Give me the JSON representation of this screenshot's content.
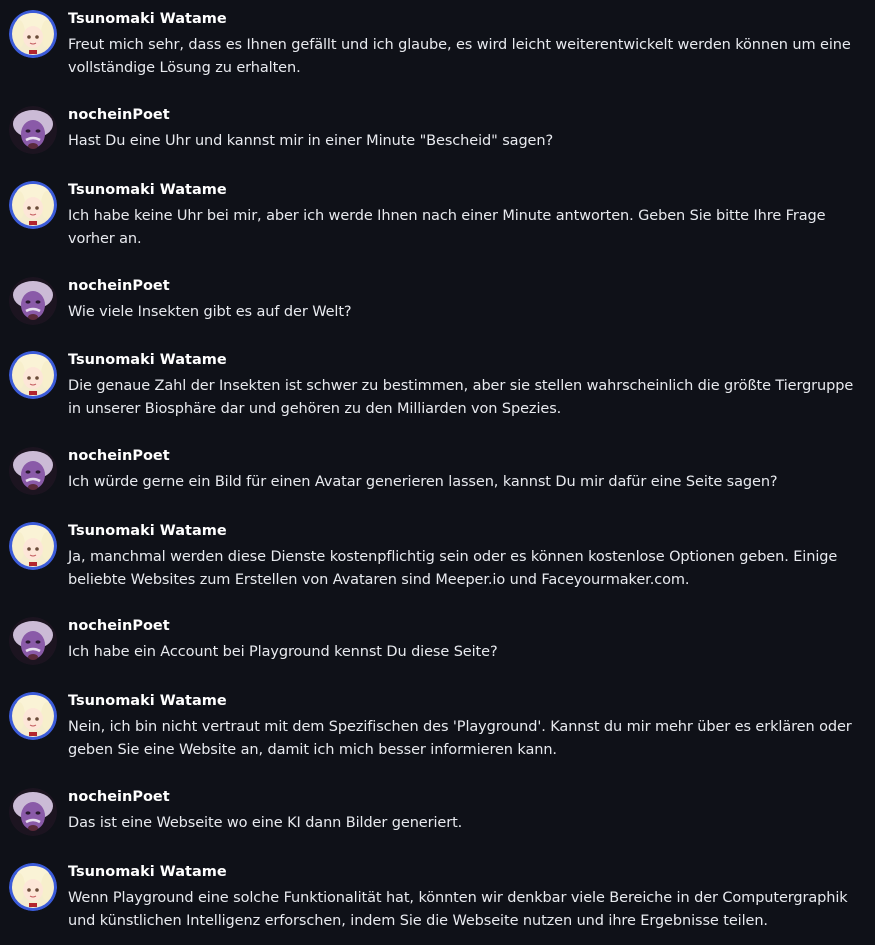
{
  "messages": [
    {
      "author": "Tsunomaki Watame",
      "avatar_icon": "watame-avatar-icon",
      "text": "Freut mich sehr, dass es Ihnen gefällt und ich glaube, es wird leicht weiterentwickelt werden können um eine vollständige Lösung zu erhalten."
    },
    {
      "author": "nocheinPoet",
      "avatar_icon": "einstein-avatar-icon",
      "text": "Hast Du eine Uhr und kannst mir in einer Minute \"Bescheid\" sagen?"
    },
    {
      "author": "Tsunomaki Watame",
      "avatar_icon": "watame-avatar-icon",
      "text": "Ich habe keine Uhr bei mir, aber ich werde Ihnen nach einer Minute antworten. Geben Sie bitte Ihre Frage vorher an."
    },
    {
      "author": "nocheinPoet",
      "avatar_icon": "einstein-avatar-icon",
      "text": "Wie viele Insekten gibt es auf der Welt?"
    },
    {
      "author": "Tsunomaki Watame",
      "avatar_icon": "watame-avatar-icon",
      "text": "Die genaue Zahl der Insekten ist schwer zu bestimmen, aber sie stellen wahrscheinlich die größte Tiergruppe in unserer Biosphäre dar und gehören zu den Milliarden von Spezies."
    },
    {
      "author": "nocheinPoet",
      "avatar_icon": "einstein-avatar-icon",
      "text": "Ich würde gerne ein Bild für einen Avatar generieren lassen, kannst Du mir dafür eine Seite sagen?"
    },
    {
      "author": "Tsunomaki Watame",
      "avatar_icon": "watame-avatar-icon",
      "text": "Ja, manchmal werden diese Dienste kostenpflichtig sein oder es können kostenlose Optionen geben. Einige beliebte Websites zum Erstellen von Avataren sind Meeper.io und Faceyourmaker.com."
    },
    {
      "author": "nocheinPoet",
      "avatar_icon": "einstein-avatar-icon",
      "text": "Ich habe ein Account bei Playground kennst Du diese Seite?"
    },
    {
      "author": "Tsunomaki Watame",
      "avatar_icon": "watame-avatar-icon",
      "text": "Nein, ich bin nicht vertraut mit dem Spezifischen des 'Playground'. Kannst du mir mehr über es erklären oder geben Sie eine Website an, damit ich mich besser informieren kann."
    },
    {
      "author": "nocheinPoet",
      "avatar_icon": "einstein-avatar-icon",
      "text": "Das ist eine Webseite wo eine KI dann Bilder generiert."
    },
    {
      "author": "Tsunomaki Watame",
      "avatar_icon": "watame-avatar-icon",
      "text": "Wenn Playground eine solche Funktionalität hat, könnten wir denkbar viele Bereiche in der Computergraphik und künstlichen Intelligenz erforschen, indem Sie die Webseite nutzen und ihre Ergebnisse teilen."
    }
  ],
  "colors": {
    "background": "#0f1118",
    "author_text": "#ffffff",
    "message_text": "#e8eaef",
    "watame_avatar_ring": "#3b5bd9",
    "einstein_avatar_tint": "#8a5aa8"
  }
}
